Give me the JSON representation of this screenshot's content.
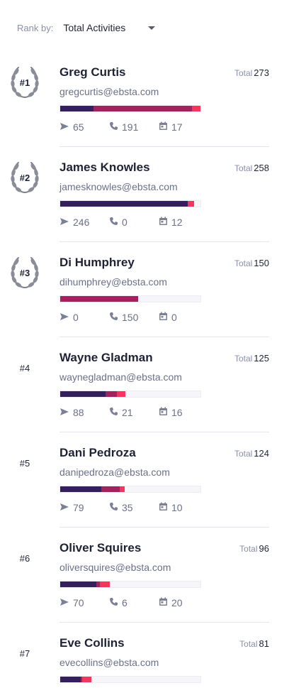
{
  "rank_by": {
    "label": "Rank by:",
    "selected": "Total Activities"
  },
  "total_label": "Total",
  "colors": {
    "emails": "#33205c",
    "calls": "#a3215d",
    "meetings": "#f4365e"
  },
  "leaders": [
    {
      "rank": "#1",
      "name": "Greg Curtis",
      "email": "gregcurtis@ebsta.com",
      "total": "273",
      "emails": "65",
      "calls": "191",
      "meetings": "17"
    },
    {
      "rank": "#2",
      "name": "James Knowles",
      "email": "jamesknowles@ebsta.com",
      "total": "258",
      "emails": "246",
      "calls": "0",
      "meetings": "12"
    },
    {
      "rank": "#3",
      "name": "Di Humphrey",
      "email": "dihumphrey@ebsta.com",
      "total": "150",
      "emails": "0",
      "calls": "150",
      "meetings": "0"
    },
    {
      "rank": "#4",
      "name": "Wayne Gladman",
      "email": "waynegladman@ebsta.com",
      "total": "125",
      "emails": "88",
      "calls": "21",
      "meetings": "16"
    },
    {
      "rank": "#5",
      "name": "Dani Pedroza",
      "email": "danipedroza@ebsta.com",
      "total": "124",
      "emails": "79",
      "calls": "35",
      "meetings": "10"
    },
    {
      "rank": "#6",
      "name": "Oliver Squires",
      "email": "oliversquires@ebsta.com",
      "total": "96",
      "emails": "70",
      "calls": "6",
      "meetings": "20"
    },
    {
      "rank": "#7",
      "name": "Eve Collins",
      "email": "evecollins@ebsta.com",
      "total": "81",
      "emails": "",
      "calls": "",
      "meetings": ""
    }
  ]
}
